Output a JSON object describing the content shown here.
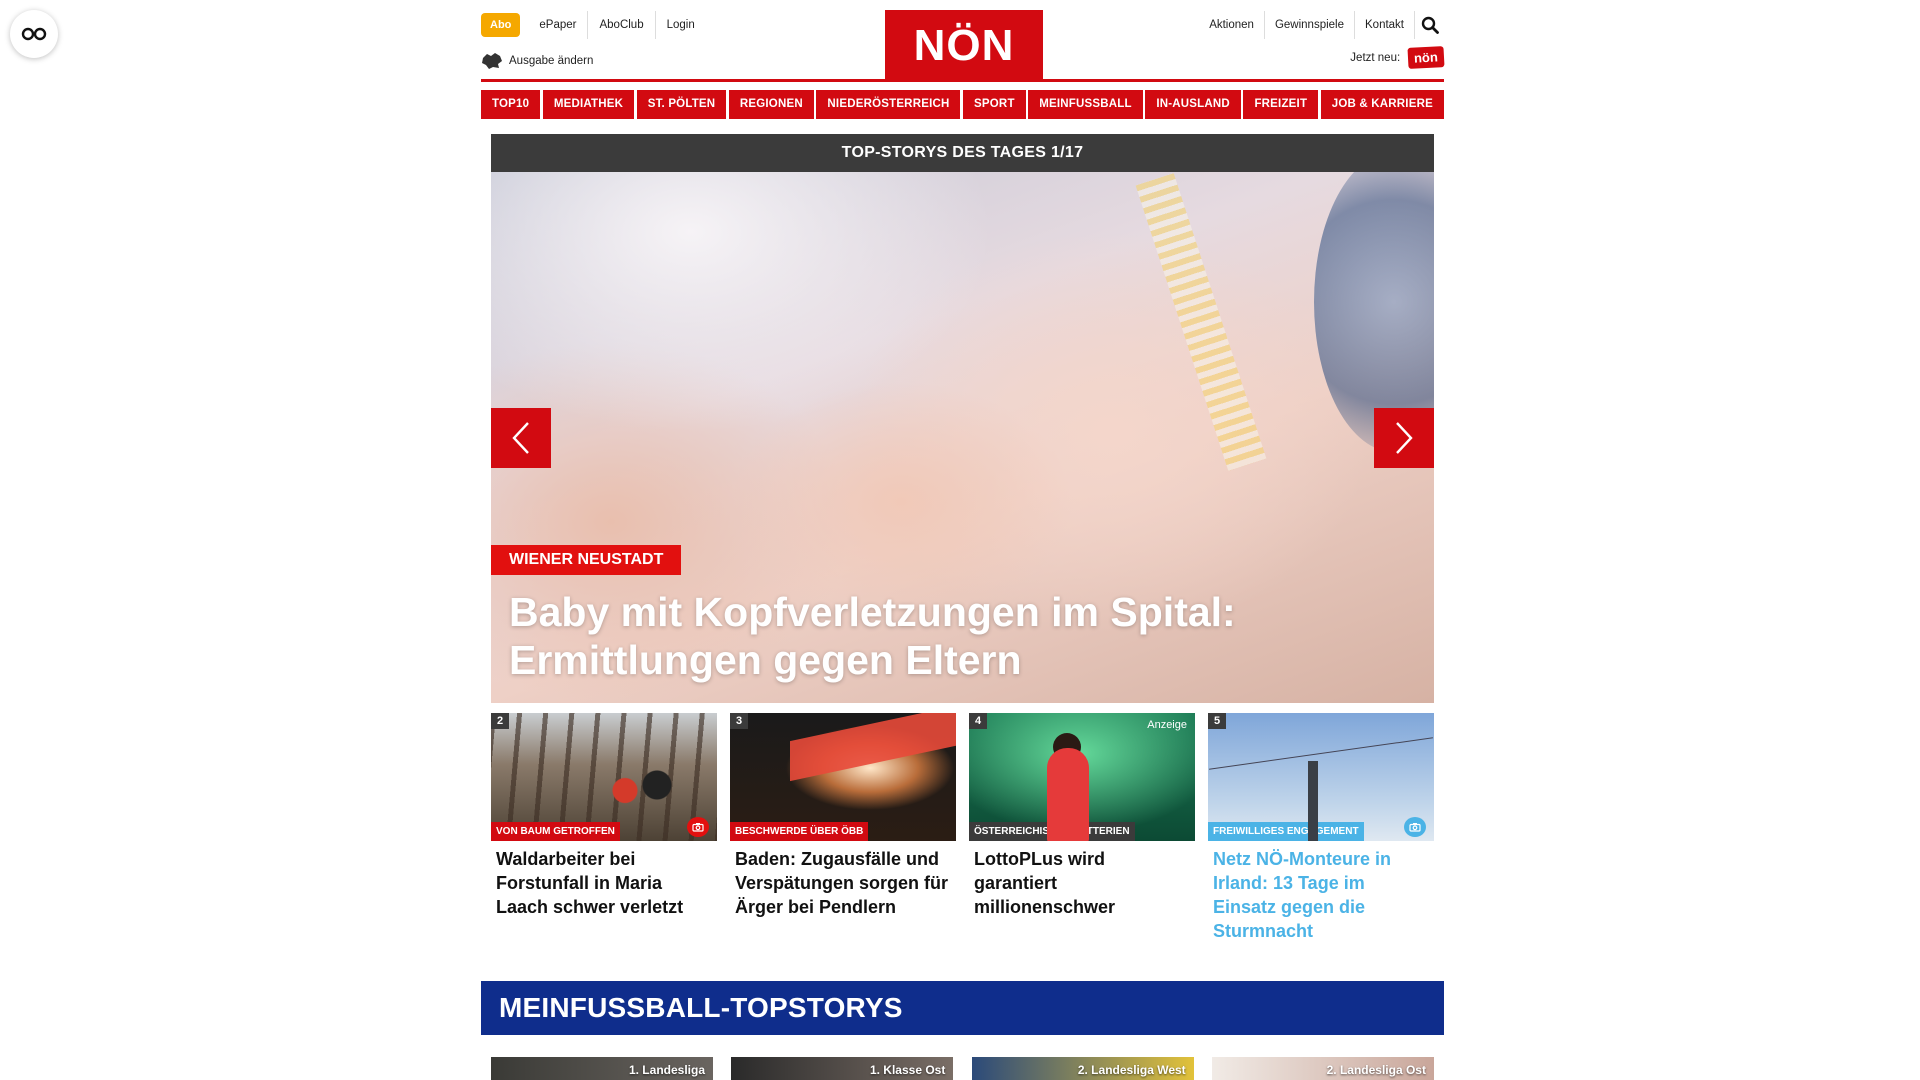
{
  "header": {
    "abo_label": "Abo",
    "left_links": [
      "ePaper",
      "AboClub",
      "Login"
    ],
    "ausgabe_label": "Ausgabe ändern",
    "logo_text": "NÖN",
    "right_links": [
      "Aktionen",
      "Gewinnspiele",
      "Kontakt"
    ],
    "jetzt_label": "Jetzt neu:",
    "jetzt_logo_text": "nön"
  },
  "nav": {
    "items": [
      "TOP10",
      "MEDIATHEK",
      "ST. PÖLTEN",
      "REGIONEN",
      "NIEDERÖSTERREICH",
      "SPORT",
      "MEINFUSSBALL",
      "IN-AUSLAND",
      "FREIZEIT",
      "JOB & KARRIERE"
    ]
  },
  "hero": {
    "bar_title": "TOP-STORYS DES TAGES 1/17",
    "tag": "WIENER NEUSTADT",
    "title_line1": "Baby mit Kopfverletzungen im Spital:",
    "title_line2": "Ermittlungen gegen Eltern"
  },
  "teasers": [
    {
      "num": "2",
      "tag": "VON BAUM GETROFFEN",
      "title": "Waldarbeiter bei Forstunfall in Maria Laach schwer verletzt"
    },
    {
      "num": "3",
      "tag": "BESCHWERDE ÜBER ÖBB",
      "title": "Baden: Zugausfälle und Verspätungen sorgen für Ärger bei Pendlern"
    },
    {
      "num": "4",
      "tag": "ÖSTERREICHISCHE LOTTERIEN",
      "anzeige": "Anzeige",
      "title": "LottoPLus wird garantiert millionenschwer"
    },
    {
      "num": "5",
      "tag": "FREIWILLIGES ENGAGEMENT",
      "title": "Netz NÖ-Monteure in Irland: 13 Tage im Einsatz gegen die Sturmnacht"
    }
  ],
  "section": {
    "title": "MEINFUSSBALL-TOPSTORYS",
    "cards": [
      "1. Landesliga",
      "1. Klasse Ost",
      "2. Landesliga West",
      "2. Landesliga Ost"
    ]
  },
  "colors": {
    "brand_red": "#d20a11",
    "abo_orange": "#f5a800",
    "section_blue": "#0f2d8c",
    "accent_blue": "#4bb3e6"
  }
}
